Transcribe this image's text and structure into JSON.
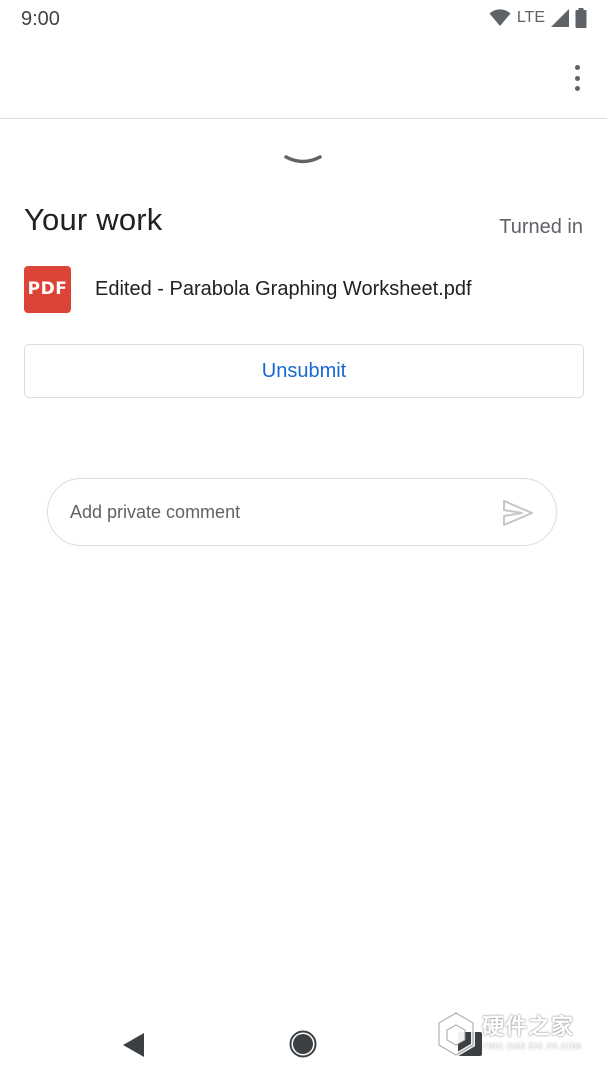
{
  "status_bar": {
    "time": "9:00",
    "network_label": "LTE",
    "icons": [
      "wifi-icon",
      "cell-signal-icon",
      "battery-icon"
    ]
  },
  "toolbar": {
    "overflow_icon": "more-vert-icon"
  },
  "sheet": {
    "handle_icon": "chevron-down-icon"
  },
  "your_work": {
    "title": "Your work",
    "status": "Turned in",
    "attachment": {
      "type_label": "PDF",
      "file_name": "Edited - Parabola Graphing Worksheet.pdf"
    },
    "unsubmit_label": "Unsubmit"
  },
  "comment": {
    "placeholder": "Add private comment",
    "value": "",
    "send_icon": "send-icon"
  },
  "nav_bar": {
    "icons": [
      "back-icon",
      "home-icon",
      "recents-icon"
    ]
  },
  "watermark": {
    "main_text": "硬件之家",
    "sub_text": "YING JIAN ZHI JIA.COM"
  },
  "colors": {
    "accent": "#1967d2",
    "pdf_red": "#db4437",
    "divider": "#dadce0",
    "text_primary": "#202124",
    "text_secondary": "#5f6368"
  }
}
